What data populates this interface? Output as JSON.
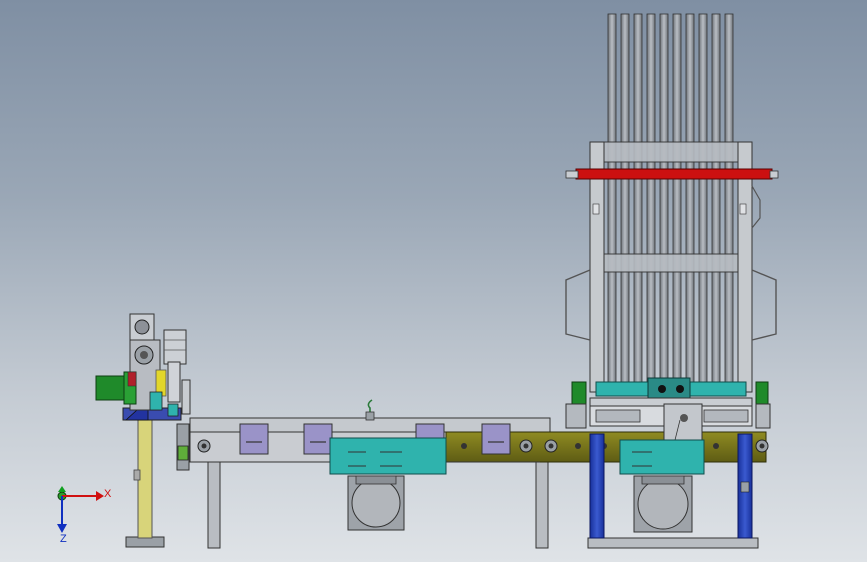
{
  "viewport": {
    "background_top": "#7f8fa3",
    "background_bottom": "#dfe3e7"
  },
  "triad": {
    "x_label": "X",
    "y_label": "Y",
    "z_label": "Z",
    "x_color": "#d01010",
    "y_color": "#10a020",
    "z_color": "#1030c0"
  },
  "colors": {
    "frame_olive": "#7d7a1e",
    "frame_olive_dark": "#5e5c14",
    "cyan_block": "#2fb3ad",
    "red_bar": "#cc1010",
    "blue_post": "#1f3fb0",
    "rack_gray": "#8a8f96",
    "green_motor": "#1f8a2a",
    "yellow_post": "#d8d47a",
    "lavender_plate": "#9a93c8"
  }
}
